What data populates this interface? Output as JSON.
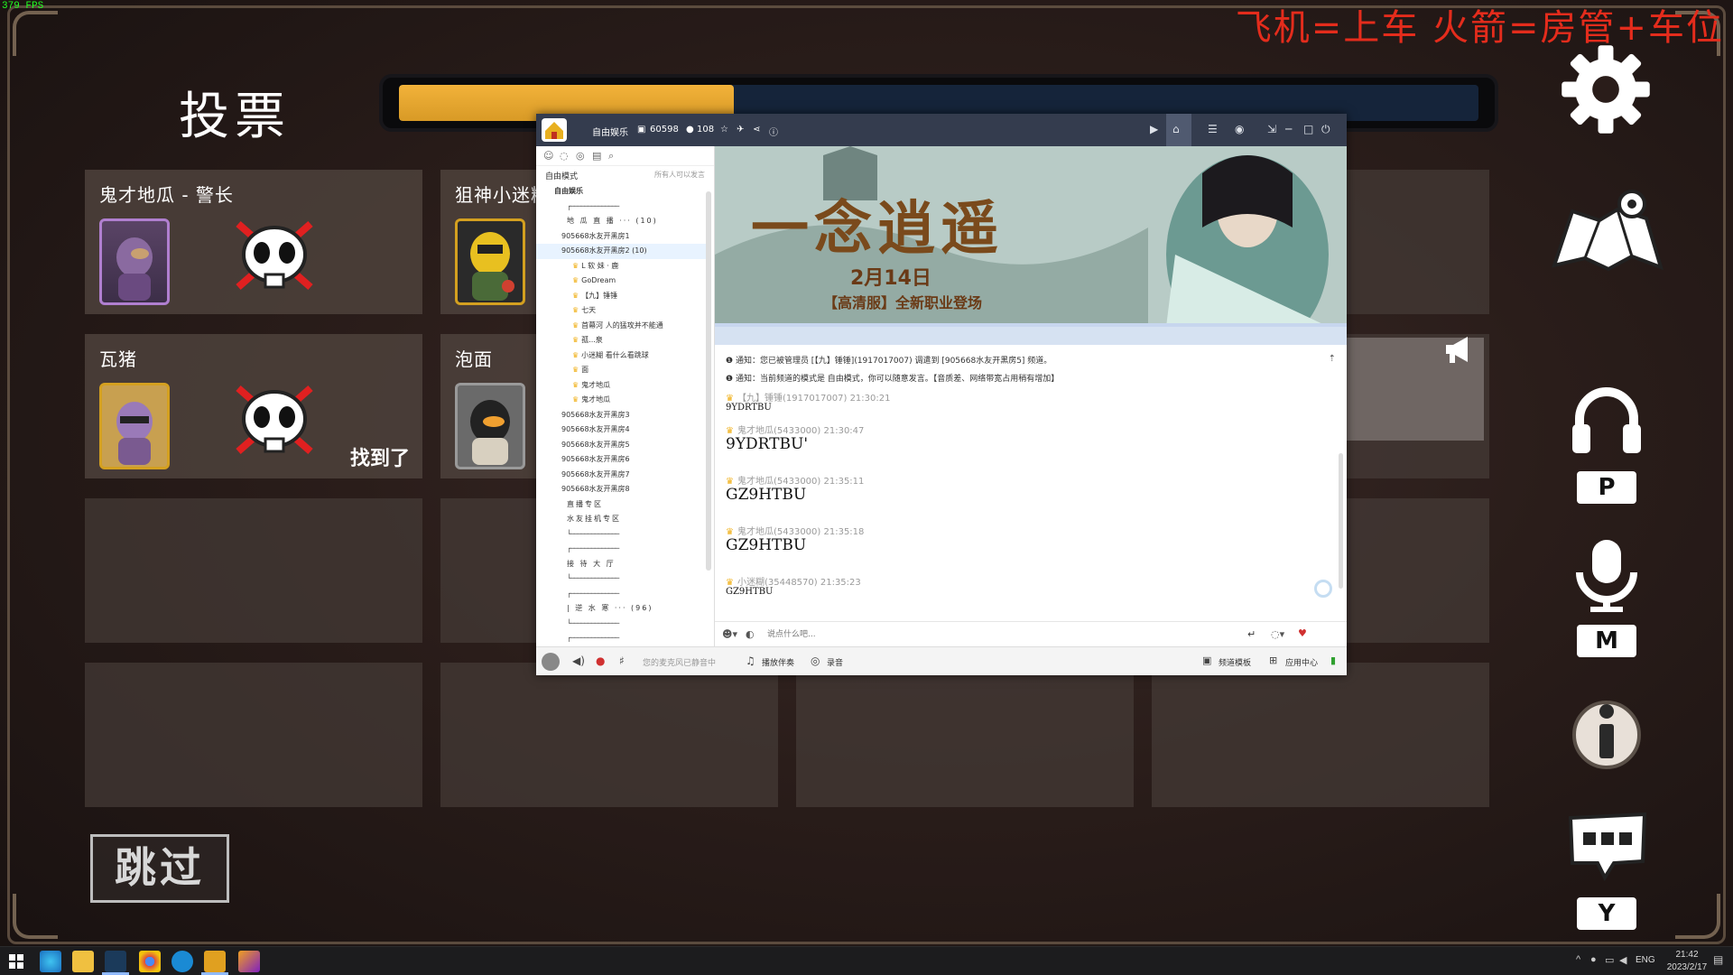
{
  "overlay": {
    "fps": "379 FPS",
    "stream_text": "飞机=上车  火箭=房管+车位"
  },
  "vote": {
    "title": "投票",
    "timer_progress": 0.31,
    "skip_label": "跳过",
    "cards": [
      {
        "name": "鬼才地瓜 - 警长",
        "eliminated": true,
        "status": ""
      },
      {
        "name": "狙神小迷糊",
        "eliminated": false,
        "status": ""
      },
      {
        "name": "瓦猪",
        "eliminated": true,
        "status": "找到了"
      },
      {
        "name": "泡面",
        "eliminated": false,
        "status": ""
      }
    ]
  },
  "side_keys": {
    "headset": "P",
    "mic": "M",
    "chat": "Y"
  },
  "yy": {
    "channel_name": "自由娱乐",
    "channel_id": "60598",
    "online": "108",
    "mode": "自由模式",
    "mode_note": "所有人可以发言",
    "tree": [
      {
        "label": "自由娱乐",
        "type": "root"
      },
      {
        "label": "┌──────────────",
        "type": "divider"
      },
      {
        "label": "地 瓜 直 播 ··· (10)",
        "type": "group"
      },
      {
        "label": "905668水友开黑房1",
        "type": "room"
      },
      {
        "label": "905668水友开黑房2 (10)",
        "type": "room",
        "selected": true
      },
      {
        "label": "L 软 妹 · 鹿",
        "type": "user"
      },
      {
        "label": "GoDream",
        "type": "user"
      },
      {
        "label": "【九】锤锤",
        "type": "user"
      },
      {
        "label": "七天",
        "type": "user"
      },
      {
        "label": "首幕河 人的猛攻并不能通",
        "type": "user"
      },
      {
        "label": "孤...泉",
        "type": "user"
      },
      {
        "label": "小迷糊 看什么看跳球",
        "type": "user"
      },
      {
        "label": "面",
        "type": "user"
      },
      {
        "label": "鬼才地瓜",
        "type": "user"
      },
      {
        "label": "鬼才地瓜",
        "type": "user"
      },
      {
        "label": "905668水友开黑房3",
        "type": "room"
      },
      {
        "label": "905668水友开黑房4",
        "type": "room"
      },
      {
        "label": "905668水友开黑房5",
        "type": "room"
      },
      {
        "label": "905668水友开黑房6",
        "type": "room"
      },
      {
        "label": "905668水友开黑房7",
        "type": "room"
      },
      {
        "label": "905668水友开黑房8",
        "type": "room"
      },
      {
        "label": "直播专区",
        "type": "group"
      },
      {
        "label": "水友挂机专区",
        "type": "group"
      },
      {
        "label": "└──────────────",
        "type": "divider"
      },
      {
        "label": "┌──────────────",
        "type": "divider"
      },
      {
        "label": "接 待 大 厅",
        "type": "group"
      },
      {
        "label": "└──────────────",
        "type": "divider"
      },
      {
        "label": "┌──────────────",
        "type": "divider"
      },
      {
        "label": "| 逆 水 寒 ··· (96)",
        "type": "group"
      },
      {
        "label": "└──────────────",
        "type": "divider"
      },
      {
        "label": "┌──────────────",
        "type": "divider"
      }
    ],
    "banner_title": "一念逍遥",
    "banner_date": "2月14日",
    "banner_sub": "【高清服】全新职业登场",
    "notices": [
      "通知：您已被管理员 [【九】锤锤](1917017007) 调遣到 [905668水友开黑房5] 频道。",
      "通知：当前频道的模式是 自由模式，你可以随意发言。【音质差、网络带宽占用稍有增加】"
    ],
    "messages": [
      {
        "head": "【九】锤锤(1917017007)  21:30:21",
        "body": "9YDRTBU",
        "size": "small"
      },
      {
        "head": "鬼才地瓜(5433000)  21:30:47",
        "body": "9YDRTBU'",
        "size": "large"
      },
      {
        "head": "鬼才地瓜(5433000)  21:35:11",
        "body": "GZ9HTBU",
        "size": "large"
      },
      {
        "head": "鬼才地瓜(5433000)  21:35:18",
        "body": "GZ9HTBU",
        "size": "large"
      },
      {
        "head": "小迷糊(35448570)  21:35:23",
        "body": "GZ9HTBU",
        "size": "small"
      }
    ],
    "input_placeholder": "说点什么吧...",
    "bottom": {
      "voice_hint": "您的麦克风已静音中",
      "music": "播放伴奏",
      "record": "录音",
      "channel_switch": "频道模板",
      "app_center": "应用中心"
    }
  },
  "taskbar": {
    "lang": "ENG",
    "time": "21:42",
    "date": "2023/2/17"
  }
}
